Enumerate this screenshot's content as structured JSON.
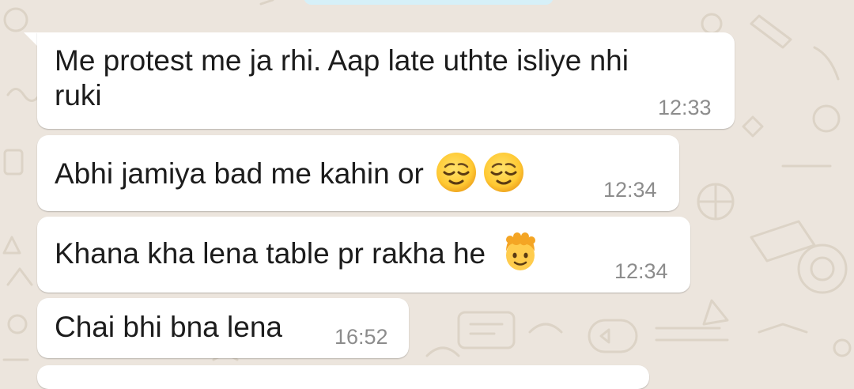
{
  "chat": {
    "messages": [
      {
        "line1": "Me protest me ja rhi. Aap late uthte isliye nhi",
        "line2": "ruki",
        "time": "12:33"
      },
      {
        "text": "Abhi jamiya bad me kahin or",
        "emojis": [
          "relieved-face-emoji",
          "relieved-face-emoji"
        ],
        "time": "12:34"
      },
      {
        "text": "Khana kha lena table pr rakha he",
        "emojis": [
          "boy-face-emoji"
        ],
        "time": "12:34"
      },
      {
        "text": "Chai bhi bna lena",
        "time": "16:52"
      }
    ]
  },
  "colors": {
    "chat_background": "#ece5dd",
    "incoming_bubble": "#ffffff",
    "previous_bubble": "#d6f0f8",
    "message_text": "#1c1c1c",
    "timestamp_text": "#8c8c8c"
  }
}
